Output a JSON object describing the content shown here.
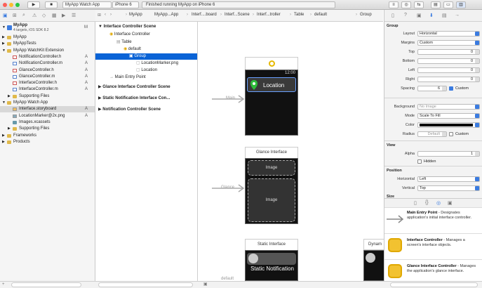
{
  "toolbar": {
    "scheme": "MyApp Watch App",
    "device": "iPhone 6",
    "status": "Finished running MyApp on iPhone 6"
  },
  "jumpbar": {
    "crumbs": [
      "MyApp",
      "MyApp...App",
      "Interf....board",
      "Interf...Scene",
      "Interf...troller",
      "Table",
      "default",
      "Group"
    ]
  },
  "navigator": {
    "project": "MyApp",
    "project_sub": "4 targets, iOS SDK 8.2",
    "project_status": "M",
    "items": [
      {
        "label": "MyApp",
        "status": ""
      },
      {
        "label": "MyAppTests",
        "status": ""
      },
      {
        "label": "MyApp WatchKit Extension",
        "status": ""
      },
      {
        "label": "NotificationController.h",
        "status": "A"
      },
      {
        "label": "NotificationController.m",
        "status": "A"
      },
      {
        "label": "GlanceController.h",
        "status": "A"
      },
      {
        "label": "GlanceController.m",
        "status": "A"
      },
      {
        "label": "InterfaceController.h",
        "status": "A"
      },
      {
        "label": "InterfaceController.m",
        "status": "A"
      },
      {
        "label": "Supporting Files",
        "status": ""
      },
      {
        "label": "MyApp Watch App",
        "status": ""
      },
      {
        "label": "Interface.storyboard",
        "status": "A"
      },
      {
        "label": "LocationMarker@2x.png",
        "status": "A"
      },
      {
        "label": "Images.xcassets",
        "status": ""
      },
      {
        "label": "Supporting Files",
        "status": ""
      },
      {
        "label": "Frameworks",
        "status": ""
      },
      {
        "label": "Products",
        "status": ""
      }
    ]
  },
  "outline": {
    "rows": [
      "Interface Controller Scene",
      "Interface Controller",
      "Table",
      "default",
      "Group",
      "LocationMarker.png",
      "Location",
      "Main Entry Point",
      "Glance Interface Controller Scene",
      "Static Notification Interface Con...",
      "Notification Controller Scene"
    ]
  },
  "canvas": {
    "main_label": "Main",
    "glance_label": "Glance",
    "default_label": "default",
    "time": "12:00",
    "location_text": "Location",
    "glance_title": "Glance Interface",
    "glance_image1": "Image",
    "glance_image2": "Image",
    "static_title": "Static Interface",
    "static_text": "Static Notification",
    "dynamic_title": "Dynam"
  },
  "inspector": {
    "group_header": "Group",
    "layout_label": "Layout",
    "layout_value": "Horizontal",
    "margins_label": "Margins",
    "margins_value": "Custom",
    "top_label": "Top",
    "top_value": "0",
    "bottom_label": "Bottom",
    "bottom_value": "0",
    "left_label": "Left",
    "left_value": "0",
    "right_label": "Right",
    "right_value": "0",
    "spacing_label": "Spacing",
    "spacing_value": "6",
    "spacing_custom": "Custom",
    "background_label": "Background",
    "background_value": "No Image",
    "mode_label": "Mode",
    "mode_value": "Scale To Fill",
    "color_label": "Color",
    "radius_label": "Radius",
    "radius_value": "Default",
    "radius_custom": "Custom",
    "view_header": "View",
    "alpha_label": "Alpha",
    "alpha_value": "1",
    "hidden_label": "Hidden",
    "position_header": "Position",
    "horizontal_label": "Horizontal",
    "horizontal_value": "Left",
    "vertical_label": "Vertical",
    "vertical_value": "Top",
    "size_header": "Size"
  },
  "library": [
    {
      "title": "Main Entry Point",
      "desc": " - Designates application's initial interface controller."
    },
    {
      "title": "Interface Controller",
      "desc": " - Manages a screen's interface objects."
    },
    {
      "title": "Glance Interface Controller",
      "desc": " - Manages the application's glance interface."
    }
  ],
  "colors": {
    "accent": "#0a63d6",
    "folder": "#e0b94a",
    "library_icon": "#f2c230",
    "watch_marker": "#2dbd3a"
  }
}
